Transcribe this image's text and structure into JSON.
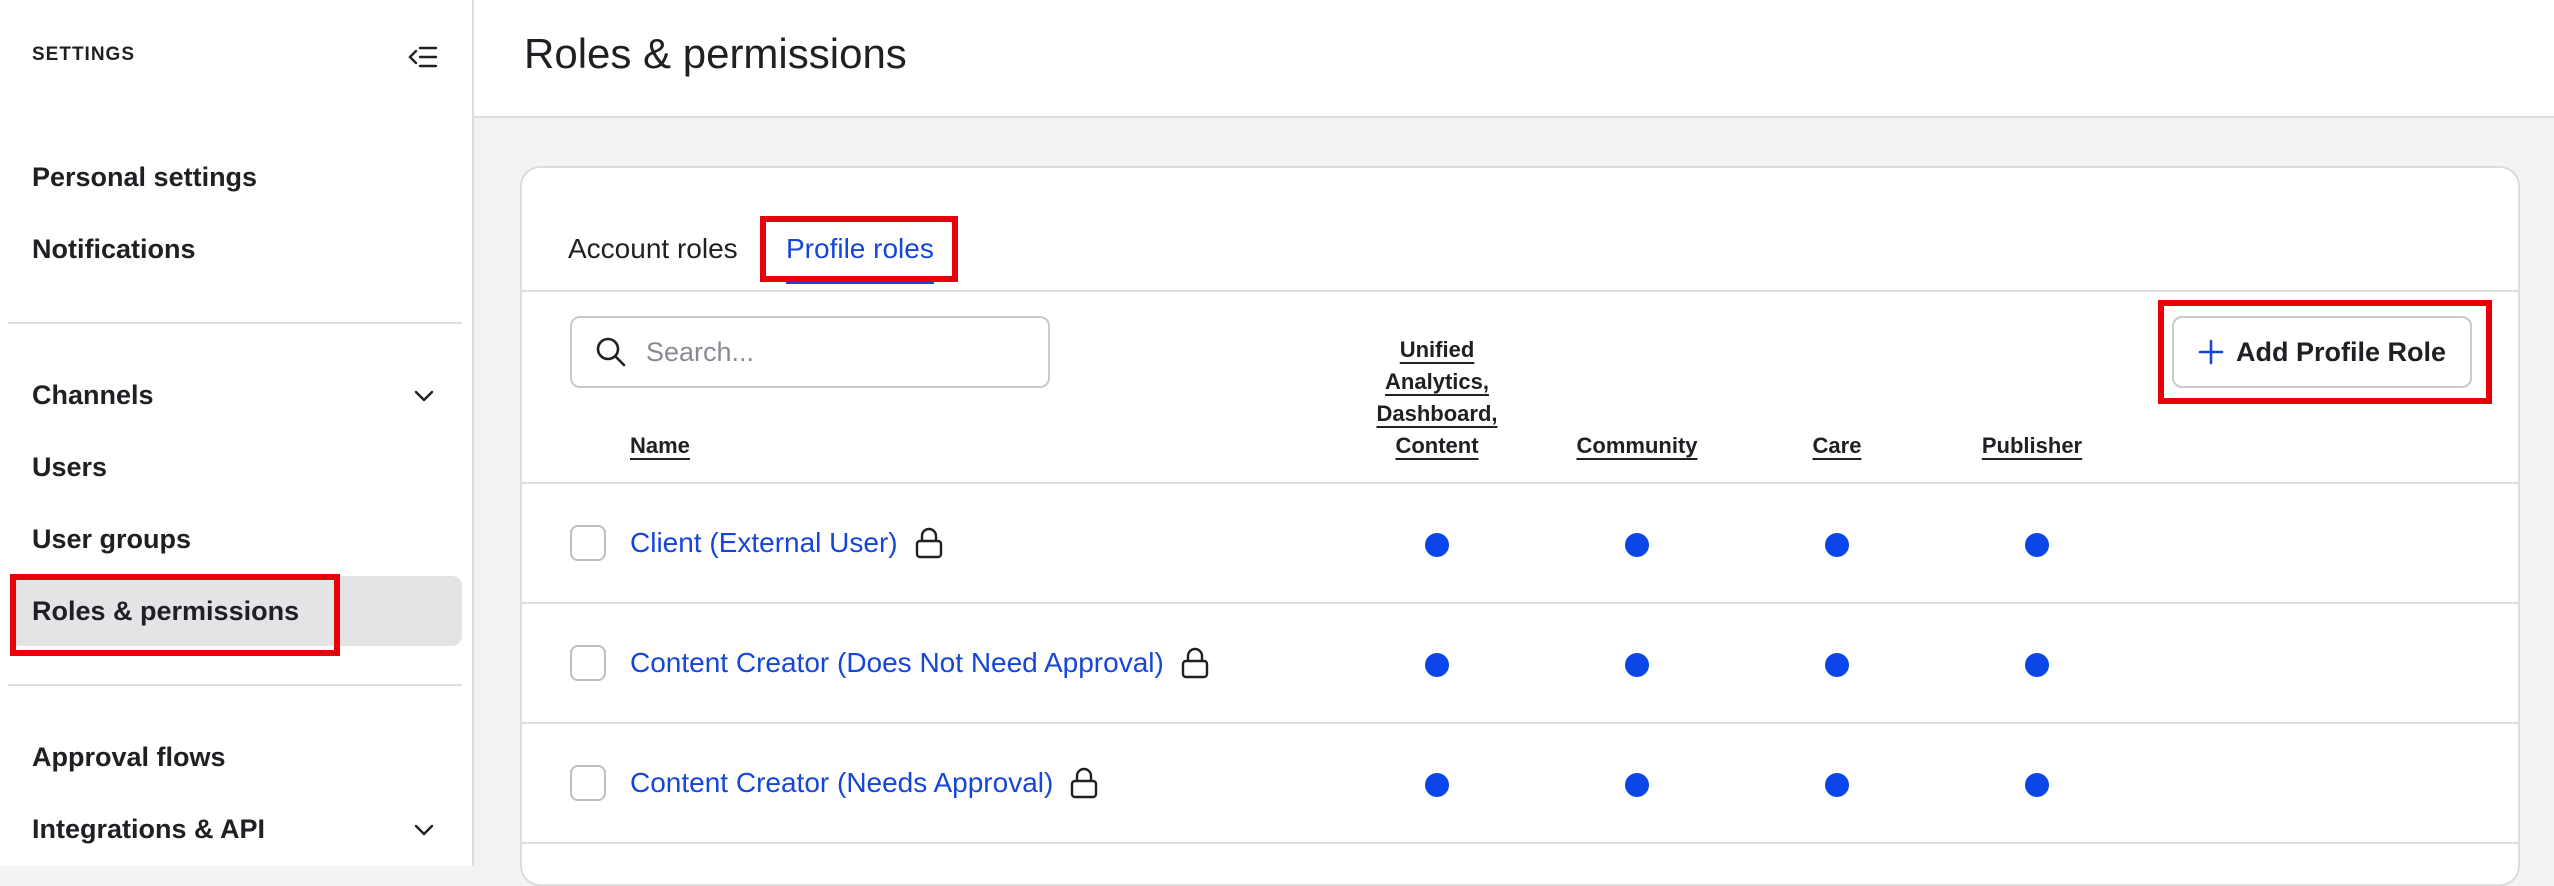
{
  "sidebar": {
    "header": "SETTINGS",
    "items": [
      {
        "label": "Personal settings"
      },
      {
        "label": "Notifications"
      },
      {
        "label": "Channels"
      },
      {
        "label": "Users"
      },
      {
        "label": "User groups"
      },
      {
        "label": "Roles & permissions"
      },
      {
        "label": "Approval flows"
      },
      {
        "label": "Integrations & API"
      }
    ],
    "active": "Roles & permissions"
  },
  "page": {
    "title": "Roles & permissions"
  },
  "tabs": [
    {
      "label": "Account roles"
    },
    {
      "label": "Profile roles"
    }
  ],
  "active_tab": "Profile roles",
  "search": {
    "placeholder": "Search..."
  },
  "add_button": {
    "label": "Add Profile Role"
  },
  "table": {
    "columns": {
      "name": "Name",
      "unified_line1": "Unified",
      "unified_line2": "Analytics,",
      "unified_line3": "Dashboard,",
      "unified_line4": "Content",
      "community": "Community",
      "care": "Care",
      "publisher": "Publisher"
    },
    "rows": [
      {
        "name": "Client (External User)",
        "locked": true,
        "unified": true,
        "community": true,
        "care": true,
        "publisher": true
      },
      {
        "name": "Content Creator (Does Not Need Approval)",
        "locked": true,
        "unified": true,
        "community": true,
        "care": true,
        "publisher": true
      },
      {
        "name": "Content Creator (Needs Approval)",
        "locked": true,
        "unified": true,
        "community": true,
        "care": true,
        "publisher": true
      }
    ]
  },
  "colors": {
    "accent": "#1546d8",
    "dot": "#0c45e8",
    "highlight": "#e8000b"
  }
}
